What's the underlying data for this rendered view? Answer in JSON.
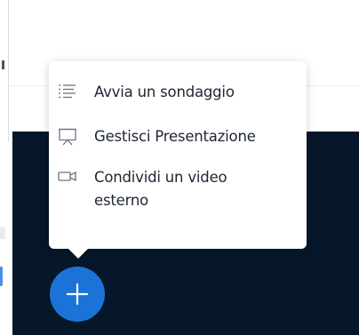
{
  "menu": {
    "items": [
      {
        "label": "Avvia un sondaggio",
        "icon": "poll-list-icon"
      },
      {
        "label": "Gestisci Presentazione",
        "icon": "presentation-icon"
      },
      {
        "label": "Condividi un video esterno",
        "icon": "video-camera-icon"
      }
    ]
  },
  "fab": {
    "icon": "plus-icon"
  },
  "colors": {
    "stage_background": "#06172a",
    "fab_background": "#1b73d8",
    "menu_background": "#ffffff",
    "menu_text": "#1d2633"
  }
}
